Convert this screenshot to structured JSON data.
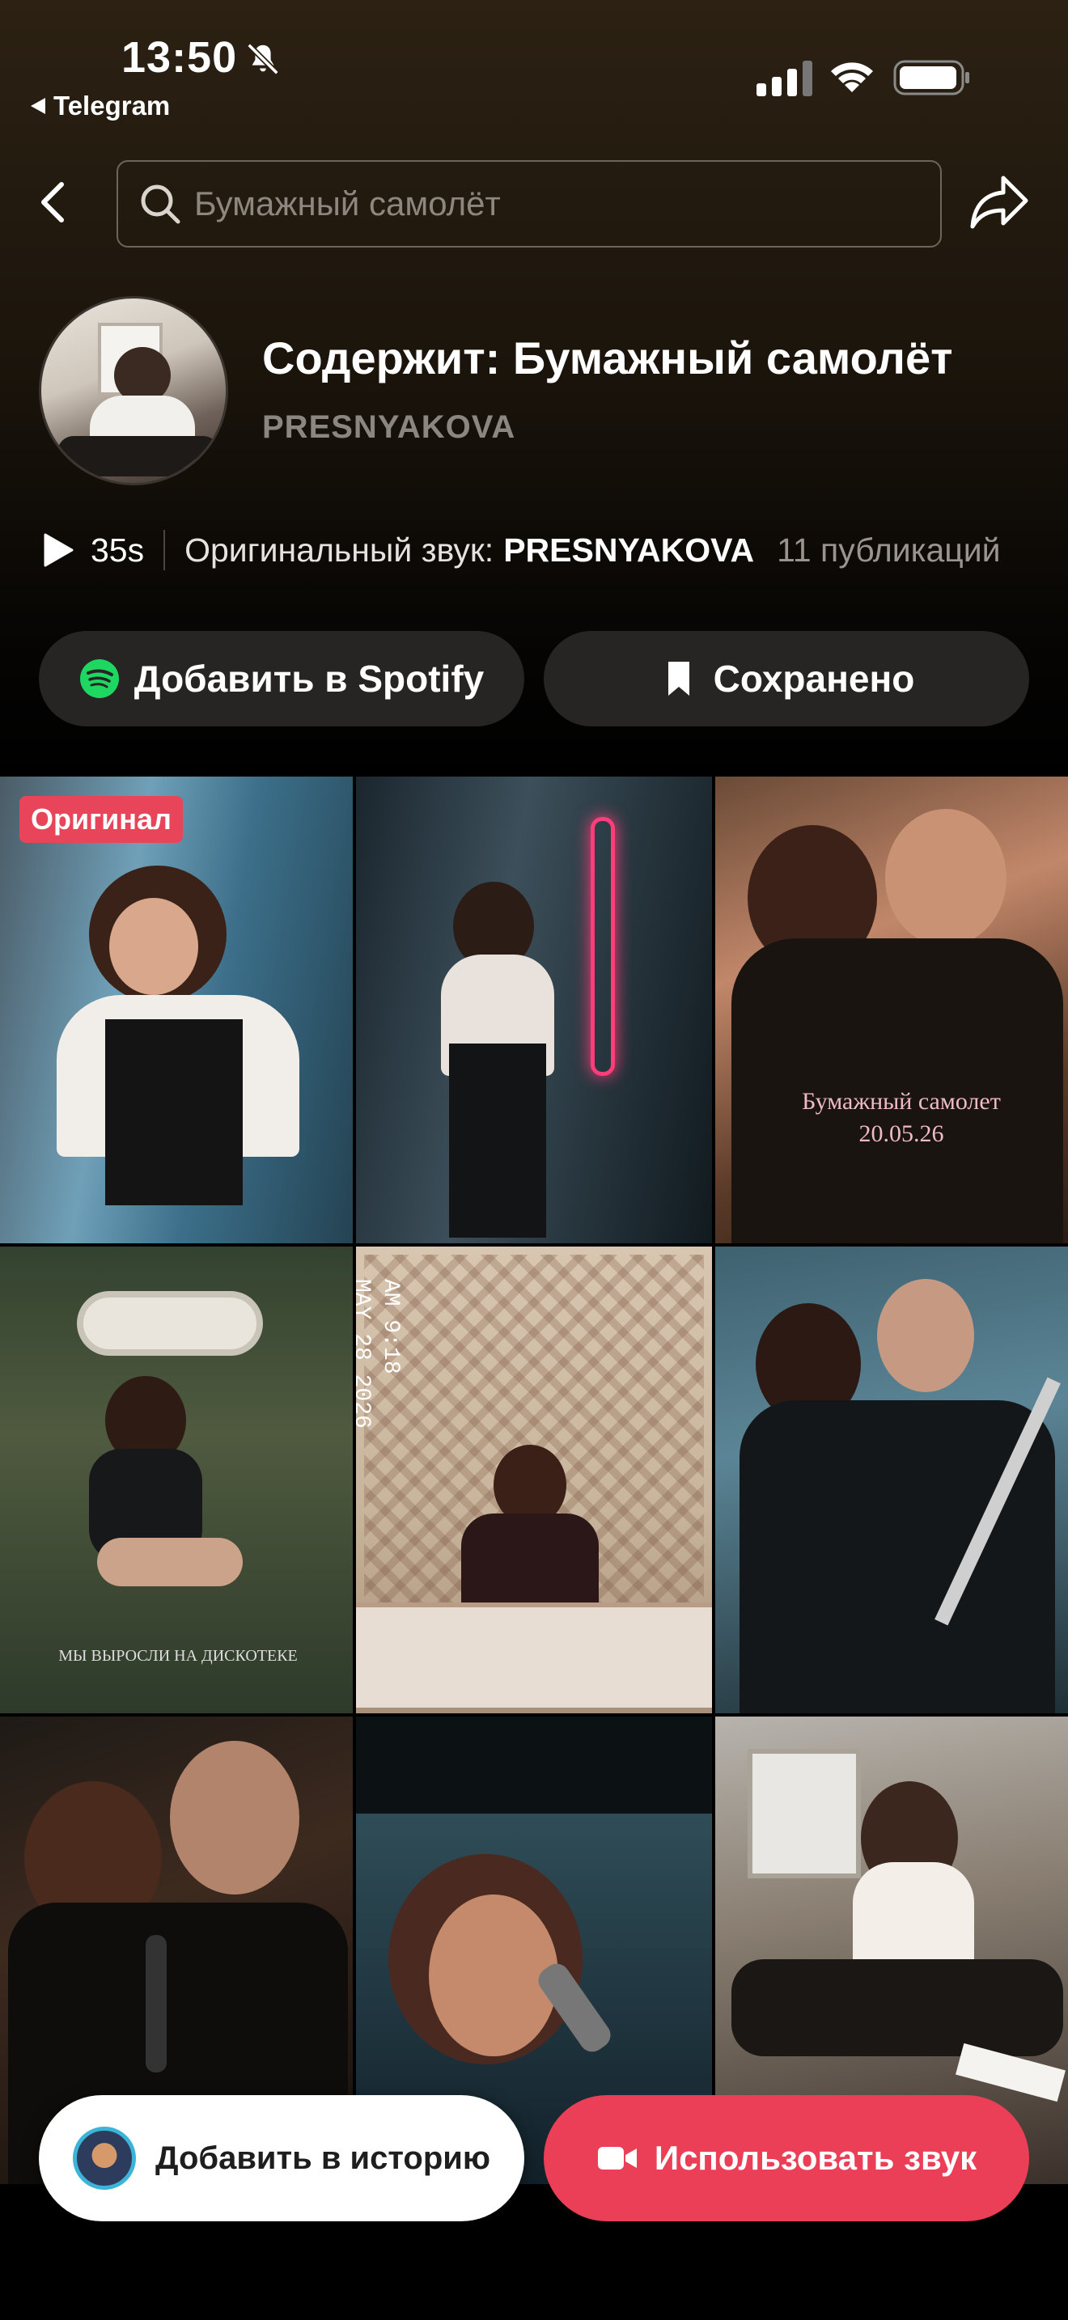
{
  "status_bar": {
    "time": "13:50",
    "back_app": "Telegram"
  },
  "nav": {
    "search_placeholder": "Бумажный самолёт"
  },
  "sound": {
    "title": "Содержит: Бумажный самолёт",
    "artist": "PRESNYAKOVA",
    "duration": "35s",
    "original_label": "Оригинальный звук:",
    "original_artist": "PRESNYAKOVA",
    "publications": "11 публикаций"
  },
  "actions": {
    "spotify_label": "Добавить в Spotify",
    "saved_label": "Сохранено"
  },
  "grid": {
    "original_badge": "Оригинал",
    "tile3_caption_line1": "Бумажный самолет",
    "tile3_caption_line2": "20.05.26",
    "tile4_caption": "МЫ ВЫРОСЛИ НА ДИСКОТЕКЕ",
    "tile5_stamp_time": "AM 9:18",
    "tile5_stamp_date": "MAY 28 2026"
  },
  "bottom": {
    "story_label": "Добавить в историю",
    "use_sound_label": "Использовать звук"
  },
  "colors": {
    "accent_red": "#ea3f56",
    "spotify_green": "#1ed760",
    "pill_bg": "#262523"
  }
}
